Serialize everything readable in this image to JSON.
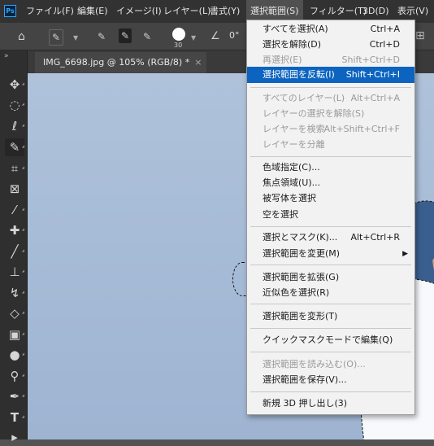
{
  "app": {
    "logo_text": "Ps"
  },
  "menubar": [
    {
      "label": "ファイル(F)"
    },
    {
      "label": "編集(E)"
    },
    {
      "label": "イメージ(I)"
    },
    {
      "label": "レイヤー(L)"
    },
    {
      "label": "書式(Y)"
    },
    {
      "label": "選択範囲(S)"
    },
    {
      "label": "フィルター(T)"
    },
    {
      "label": "3D(D)"
    },
    {
      "label": "表示(V)"
    }
  ],
  "options_bar": {
    "brush_size": "30",
    "angle": "0°"
  },
  "document_tab": {
    "title": "IMG_6698.jpg @ 105% (RGB/8) *",
    "close": "×"
  },
  "select_menu": {
    "items": [
      {
        "label": "すべてを選択(A)",
        "shortcut": "Ctrl+A"
      },
      {
        "label": "選択を解除(D)",
        "shortcut": "Ctrl+D"
      },
      {
        "label": "再選択(E)",
        "shortcut": "Shift+Ctrl+D"
      },
      {
        "label": "選択範囲を反転(I)",
        "shortcut": "Shift+Ctrl+I"
      },
      {
        "label": "すべてのレイヤー(L)",
        "shortcut": "Alt+Ctrl+A"
      },
      {
        "label": "レイヤーの選択を解除(S)",
        "shortcut": ""
      },
      {
        "label": "レイヤーを検索",
        "shortcut": "Alt+Shift+Ctrl+F"
      },
      {
        "label": "レイヤーを分離",
        "shortcut": ""
      },
      {
        "label": "色域指定(C)...",
        "shortcut": ""
      },
      {
        "label": "焦点領域(U)...",
        "shortcut": ""
      },
      {
        "label": "被写体を選択",
        "shortcut": ""
      },
      {
        "label": "空を選択",
        "shortcut": ""
      },
      {
        "label": "選択とマスク(K)...",
        "shortcut": "Alt+Ctrl+R"
      },
      {
        "label": "選択範囲を変更(M)",
        "shortcut": ""
      },
      {
        "label": "選択範囲を拡張(G)",
        "shortcut": ""
      },
      {
        "label": "近似色を選択(R)",
        "shortcut": ""
      },
      {
        "label": "選択範囲を変形(T)",
        "shortcut": ""
      },
      {
        "label": "クイックマスクモードで編集(Q)",
        "shortcut": ""
      },
      {
        "label": "選択範囲を読み込む(O)...",
        "shortcut": ""
      },
      {
        "label": "選択範囲を保存(V)...",
        "shortcut": ""
      },
      {
        "label": "新規 3D 押し出し(3)",
        "shortcut": ""
      }
    ]
  },
  "colors": {
    "highlight": "#0c64c0",
    "menu_bg": "#f2f2f2",
    "app_bg": "#535353"
  }
}
